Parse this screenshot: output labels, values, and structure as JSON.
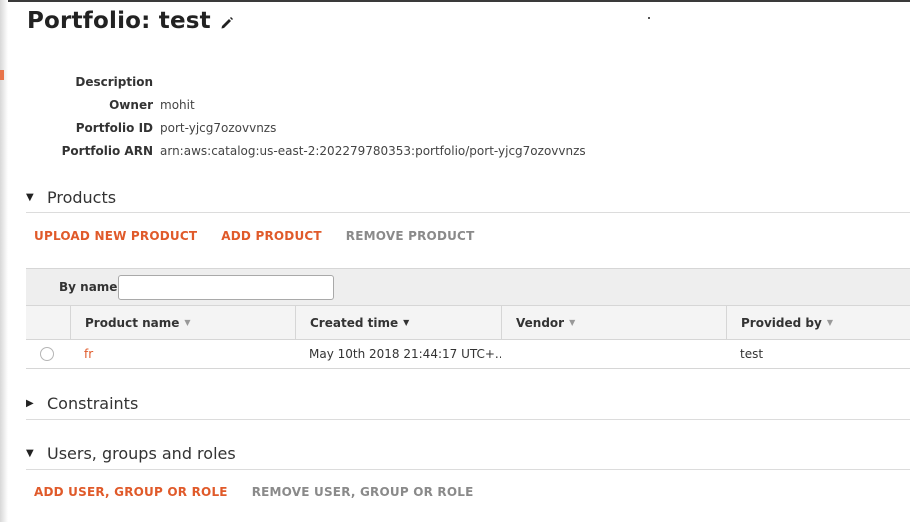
{
  "portfolio": {
    "title": "Portfolio: test",
    "edit_icon": "pencil-icon"
  },
  "details": [
    {
      "label": "Description",
      "value": ""
    },
    {
      "label": "Owner",
      "value": "mohit"
    },
    {
      "label": "Portfolio ID",
      "value": "port-yjcg7ozovvnzs"
    },
    {
      "label": "Portfolio ARN",
      "value": "arn:aws:catalog:us-east-2:202279780353:portfolio/port-yjcg7ozovvnzs"
    }
  ],
  "products_section": {
    "title": "Products",
    "expanded": true,
    "actions": {
      "upload": "UPLOAD NEW PRODUCT",
      "add": "ADD PRODUCT",
      "remove": "REMOVE PRODUCT"
    },
    "filter": {
      "label": "By name",
      "value": "",
      "placeholder": ""
    },
    "columns": [
      "Product name",
      "Created time",
      "Vendor",
      "Provided by"
    ],
    "rows": [
      {
        "name": "fr",
        "created": "May 10th 2018 21:44:17 UTC+...",
        "vendor": "",
        "provided_by": "test"
      }
    ]
  },
  "constraints_section": {
    "title": "Constraints",
    "expanded": false
  },
  "users_section": {
    "title": "Users, groups and roles",
    "expanded": true,
    "actions": {
      "add": "ADD USER, GROUP OR ROLE",
      "remove": "REMOVE USER, GROUP OR ROLE"
    }
  },
  "colors": {
    "accent": "#e05a2a",
    "disabled": "#8a8a8a"
  }
}
